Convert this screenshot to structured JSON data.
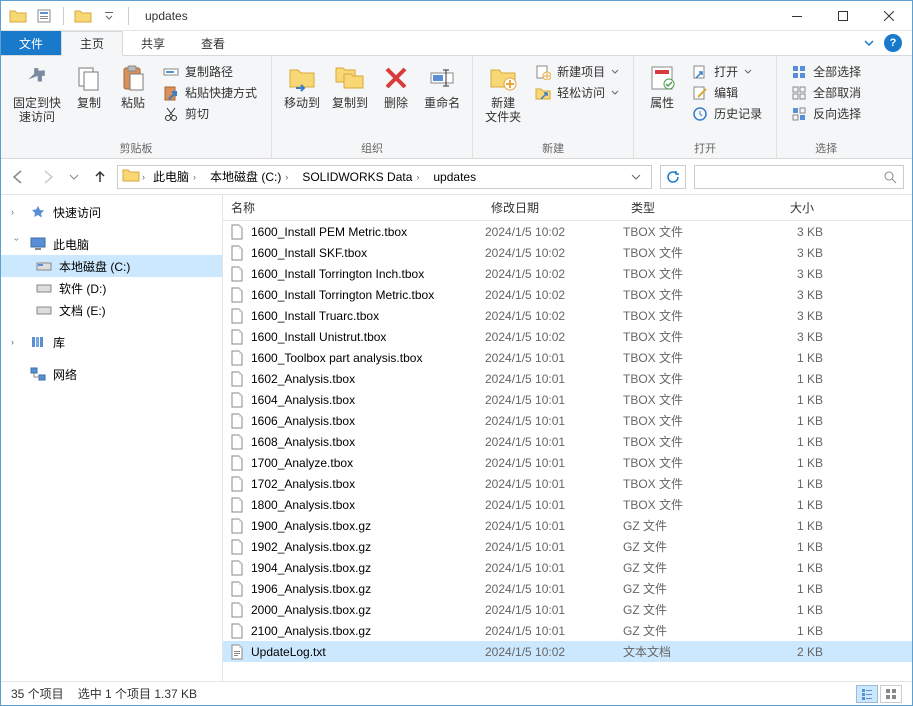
{
  "window": {
    "title": "updates"
  },
  "tabs": {
    "file": "文件",
    "home": "主页",
    "share": "共享",
    "view": "查看"
  },
  "ribbon": {
    "clipboard": {
      "label": "剪贴板",
      "pin": "固定到快\n速访问",
      "copy": "复制",
      "paste": "粘贴",
      "copy_path": "复制路径",
      "paste_shortcut": "粘贴快捷方式",
      "cut": "剪切"
    },
    "organize": {
      "label": "组织",
      "move_to": "移动到",
      "copy_to": "复制到",
      "delete": "删除",
      "rename": "重命名"
    },
    "new": {
      "label": "新建",
      "new_folder": "新建\n文件夹",
      "new_item": "新建项目",
      "easy_access": "轻松访问"
    },
    "open": {
      "label": "打开",
      "properties": "属性",
      "open": "打开",
      "edit": "编辑",
      "history": "历史记录"
    },
    "select": {
      "label": "选择",
      "select_all": "全部选择",
      "select_none": "全部取消",
      "invert": "反向选择"
    }
  },
  "breadcrumb": {
    "segments": [
      "此电脑",
      "本地磁盘 (C:)",
      "SOLIDWORKS Data",
      "updates"
    ]
  },
  "search_placeholder": "",
  "sidebar": {
    "quick_access": "快速访问",
    "this_pc": "此电脑",
    "local_disk_c": "本地磁盘 (C:)",
    "software_d": "软件 (D:)",
    "docs_e": "文档 (E:)",
    "libraries": "库",
    "network": "网络"
  },
  "columns": {
    "name": "名称",
    "date": "修改日期",
    "type": "类型",
    "size": "大小"
  },
  "files": [
    {
      "name": "1600_Install PEM Metric.tbox",
      "date": "2024/1/5 10:02",
      "type": "TBOX 文件",
      "size": "3 KB",
      "selected": false
    },
    {
      "name": "1600_Install SKF.tbox",
      "date": "2024/1/5 10:02",
      "type": "TBOX 文件",
      "size": "3 KB",
      "selected": false
    },
    {
      "name": "1600_Install Torrington Inch.tbox",
      "date": "2024/1/5 10:02",
      "type": "TBOX 文件",
      "size": "3 KB",
      "selected": false
    },
    {
      "name": "1600_Install Torrington Metric.tbox",
      "date": "2024/1/5 10:02",
      "type": "TBOX 文件",
      "size": "3 KB",
      "selected": false
    },
    {
      "name": "1600_Install Truarc.tbox",
      "date": "2024/1/5 10:02",
      "type": "TBOX 文件",
      "size": "3 KB",
      "selected": false
    },
    {
      "name": "1600_Install Unistrut.tbox",
      "date": "2024/1/5 10:02",
      "type": "TBOX 文件",
      "size": "3 KB",
      "selected": false
    },
    {
      "name": "1600_Toolbox part analysis.tbox",
      "date": "2024/1/5 10:01",
      "type": "TBOX 文件",
      "size": "1 KB",
      "selected": false
    },
    {
      "name": "1602_Analysis.tbox",
      "date": "2024/1/5 10:01",
      "type": "TBOX 文件",
      "size": "1 KB",
      "selected": false
    },
    {
      "name": "1604_Analysis.tbox",
      "date": "2024/1/5 10:01",
      "type": "TBOX 文件",
      "size": "1 KB",
      "selected": false
    },
    {
      "name": "1606_Analysis.tbox",
      "date": "2024/1/5 10:01",
      "type": "TBOX 文件",
      "size": "1 KB",
      "selected": false
    },
    {
      "name": "1608_Analysis.tbox",
      "date": "2024/1/5 10:01",
      "type": "TBOX 文件",
      "size": "1 KB",
      "selected": false
    },
    {
      "name": "1700_Analyze.tbox",
      "date": "2024/1/5 10:01",
      "type": "TBOX 文件",
      "size": "1 KB",
      "selected": false
    },
    {
      "name": "1702_Analysis.tbox",
      "date": "2024/1/5 10:01",
      "type": "TBOX 文件",
      "size": "1 KB",
      "selected": false
    },
    {
      "name": "1800_Analysis.tbox",
      "date": "2024/1/5 10:01",
      "type": "TBOX 文件",
      "size": "1 KB",
      "selected": false
    },
    {
      "name": "1900_Analysis.tbox.gz",
      "date": "2024/1/5 10:01",
      "type": "GZ 文件",
      "size": "1 KB",
      "selected": false
    },
    {
      "name": "1902_Analysis.tbox.gz",
      "date": "2024/1/5 10:01",
      "type": "GZ 文件",
      "size": "1 KB",
      "selected": false
    },
    {
      "name": "1904_Analysis.tbox.gz",
      "date": "2024/1/5 10:01",
      "type": "GZ 文件",
      "size": "1 KB",
      "selected": false
    },
    {
      "name": "1906_Analysis.tbox.gz",
      "date": "2024/1/5 10:01",
      "type": "GZ 文件",
      "size": "1 KB",
      "selected": false
    },
    {
      "name": "2000_Analysis.tbox.gz",
      "date": "2024/1/5 10:01",
      "type": "GZ 文件",
      "size": "1 KB",
      "selected": false
    },
    {
      "name": "2100_Analysis.tbox.gz",
      "date": "2024/1/5 10:01",
      "type": "GZ 文件",
      "size": "1 KB",
      "selected": false
    },
    {
      "name": "UpdateLog.txt",
      "date": "2024/1/5 10:02",
      "type": "文本文档",
      "size": "2 KB",
      "selected": true
    }
  ],
  "status": {
    "count": "35 个项目",
    "selected": "选中 1 个项目  1.37 KB"
  }
}
